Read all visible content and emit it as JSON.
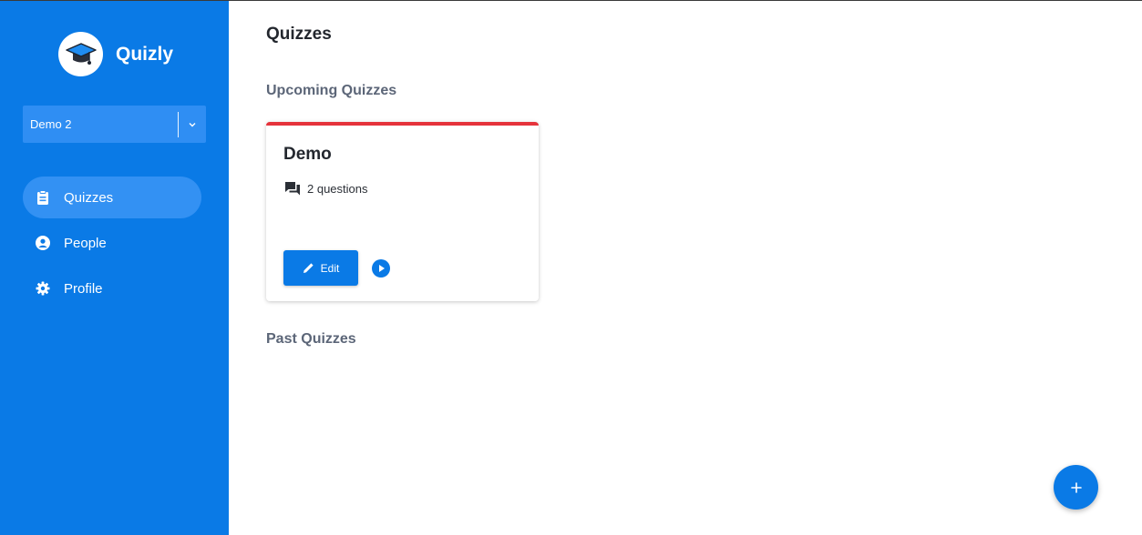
{
  "brand": {
    "name": "Quizly",
    "logo_icon": "graduation-cap-icon"
  },
  "org_selector": {
    "value": "Demo 2",
    "icon": "chevron-down-icon"
  },
  "sidebar": {
    "items": [
      {
        "label": "Quizzes",
        "icon": "clipboard-icon",
        "active": true
      },
      {
        "label": "People",
        "icon": "user-circle-icon",
        "active": false
      },
      {
        "label": "Profile",
        "icon": "gear-icon",
        "active": false
      }
    ]
  },
  "main": {
    "title": "Quizzes",
    "upcoming_heading": "Upcoming Quizzes",
    "past_heading": "Past Quizzes",
    "quizzes": [
      {
        "name": "Demo",
        "questions": "2 questions",
        "edit_label": "Edit",
        "accent": "#e5333b"
      }
    ]
  },
  "fab": {
    "label": "+",
    "icon": "plus-icon"
  },
  "colors": {
    "primary": "#0a7ae6",
    "sidebar_active": "#3391f3",
    "card_accent": "#e5333b"
  }
}
